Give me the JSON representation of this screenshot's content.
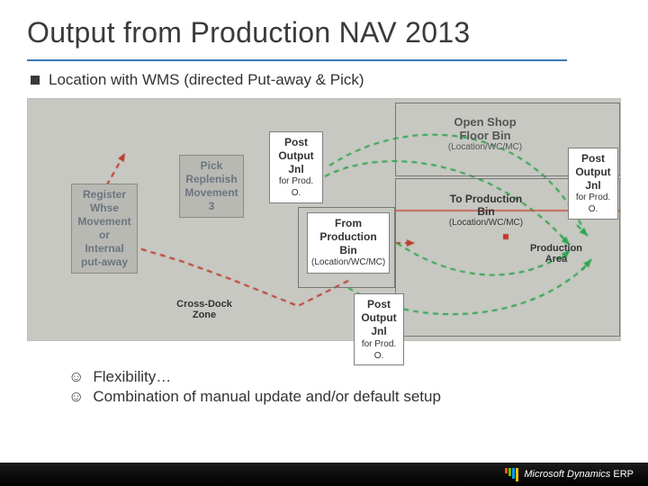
{
  "title": "Output from Production  NAV 2013",
  "subtitle": "Location with WMS (directed Put-away & Pick)",
  "boxes": {
    "register": {
      "line1": "Register",
      "line2": "Whse",
      "line3": "Movement",
      "line4": "or",
      "line5": "Internal",
      "line6": "put-away"
    },
    "pick": {
      "line1": "Pick",
      "line2": "Replenish",
      "line3": "Movement",
      "line4": "3"
    },
    "postCenter": {
      "line1": "Post",
      "line2": "Output",
      "line3": "Jnl",
      "line4": "for Prod. O."
    },
    "fromProd": {
      "line1": "From",
      "line2": "Production",
      "line3": "Bin",
      "line4": "(Location/WC/MC)"
    },
    "postBottom": {
      "line1": "Post",
      "line2": "Output",
      "line3": "Jnl",
      "line4": "for Prod. O."
    },
    "crossDock": {
      "line1": "Cross-Dock",
      "line2": "Zone"
    },
    "openShop": {
      "line1": "Open Shop",
      "line2": "Floor Bin",
      "line3": "(Location/WC/MC)"
    },
    "toProd": {
      "line1": "To Production",
      "line2": "Bin",
      "line3": "(Location/WC/MC)"
    },
    "postRight": {
      "line1": "Post",
      "line2": "Output",
      "line3": "Jnl",
      "line4": "for Prod. O."
    },
    "prodArea": {
      "line1": "Production",
      "line2": "Area"
    }
  },
  "bottom": {
    "b1": "Flexibility…",
    "b2": "Combination of manual update and/or default setup"
  },
  "footer": {
    "brand": "Microsoft Dynamics",
    "suffix": "ERP"
  },
  "colors": {
    "green": "#2da44e",
    "red": "#c0392b",
    "accent": "#3b78b5"
  }
}
